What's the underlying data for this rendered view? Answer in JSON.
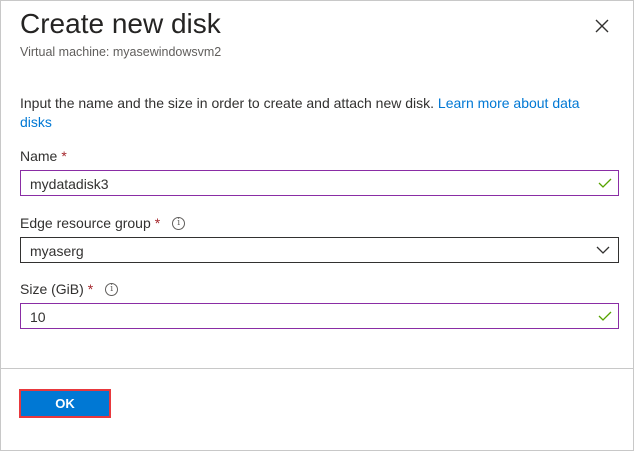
{
  "dialog": {
    "title": "Create new disk",
    "subtitle": "Virtual machine: myasewindowsvm2",
    "description": "Input the name and the size in order to create and attach new disk. ",
    "learn_more": "Learn more about data disks"
  },
  "fields": {
    "name": {
      "label": "Name",
      "required": "*",
      "value": "mydatadisk3"
    },
    "resource_group": {
      "label": "Edge resource group",
      "required": "*",
      "info": "i",
      "value": "myaserg"
    },
    "size": {
      "label": "Size (GiB)",
      "required": "*",
      "info": "i",
      "value": "10"
    }
  },
  "footer": {
    "ok_label": "OK"
  },
  "colors": {
    "accent": "#0078d4",
    "valid_border": "#8a2da5",
    "check": "#57a300",
    "highlight": "#e8383d"
  }
}
